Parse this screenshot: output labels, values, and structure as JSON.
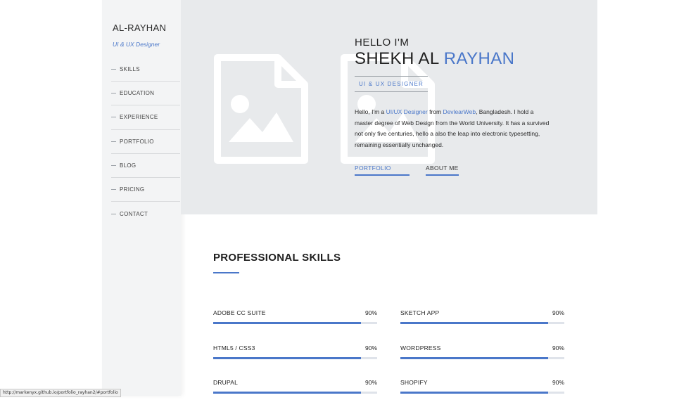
{
  "sidebar": {
    "brand": "AL-RAYHAN",
    "tagline": "UI & UX Designer",
    "menu": [
      "SKILLS",
      "EDUCATION",
      "EXPERIENCE",
      "PORTFOLIO",
      "BLOG",
      "PRICING",
      "CONTACT"
    ]
  },
  "hero": {
    "greeting": "HELLO I'M",
    "name_first": "SHEKH AL",
    "name_last": "RAYHAN",
    "role": "UI & UX DESIGNER",
    "bio_prefix": "Hello, I'm a",
    "bio_role_link": "UI/UX Designer",
    "bio_from": "from",
    "bio_company_link": "DevlearWeb",
    "bio_suffix": ", Bangladesh. I hold a master degree of Web Design from the World University. It has a survived not only five centuries, hello a also the leap into electronic typesetting, remaining essentially unchanged.",
    "portfolio_button": "PORTFOLIO",
    "about_button": "ABOUT ME"
  },
  "skills_section": {
    "title": "PROFESSIONAL SKILLS",
    "skills": [
      {
        "name": "ADOBE CC SUITE",
        "percent_label": "90%",
        "percent": 90
      },
      {
        "name": "SKETCH APP",
        "percent_label": "90%",
        "percent": 90
      },
      {
        "name": "HTML5 / CSS3",
        "percent_label": "90%",
        "percent": 90
      },
      {
        "name": "WORDPRESS",
        "percent_label": "90%",
        "percent": 90
      },
      {
        "name": "DRUPAL",
        "percent_label": "90%",
        "percent": 90
      },
      {
        "name": "SHOPIFY",
        "percent_label": "90%",
        "percent": 90
      }
    ]
  },
  "status_bar": {
    "url": "http://markenyx.github.io/portfolio_rayhan2/#portfolio"
  },
  "colors": {
    "accent": "#4a77c9",
    "hero_bg": "#e8eaec",
    "sidebar_bg": "#f3f4f5"
  },
  "icons": [
    "image-placeholder-icon"
  ]
}
